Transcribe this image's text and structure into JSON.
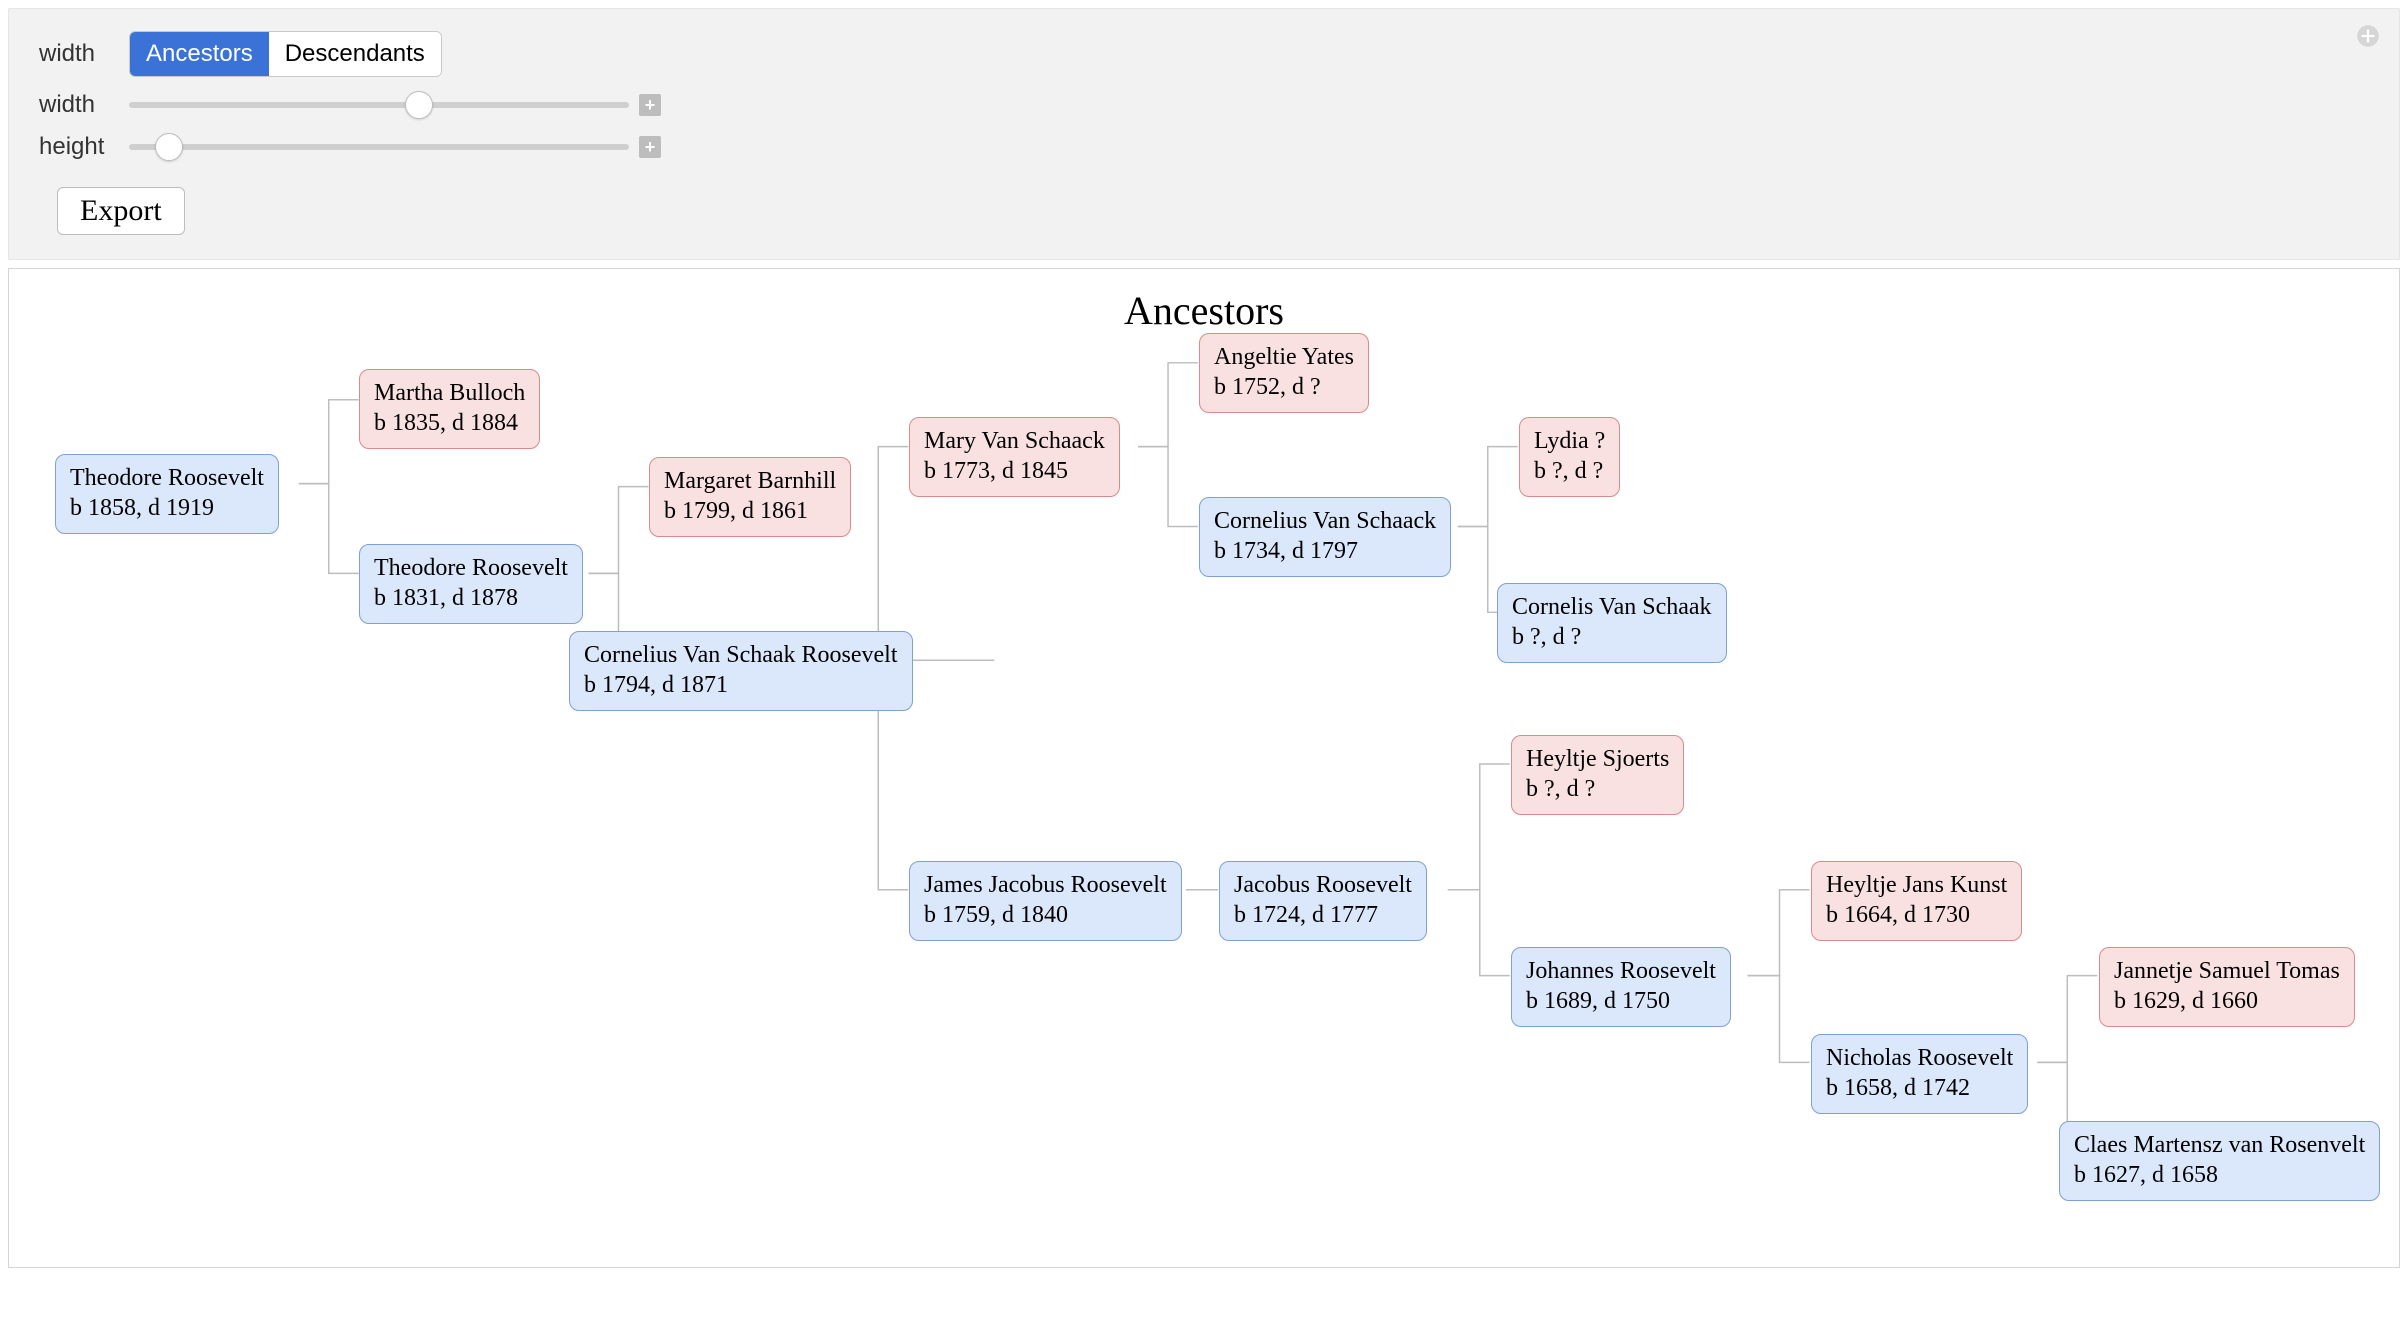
{
  "controls": {
    "mode_label": "width",
    "width_label": "width",
    "height_label": "height",
    "tab_ancestors": "Ancestors",
    "tab_descendants": "Descendants",
    "export_label": "Export",
    "width_slider_pct": 58,
    "height_slider_pct": 8
  },
  "diagram": {
    "title": "Ancestors"
  },
  "nodes": {
    "theodore_1858": {
      "name": "Theodore Roosevelt",
      "dates": "b 1858, d 1919",
      "gender": "male"
    },
    "martha_bulloch": {
      "name": "Martha Bulloch",
      "dates": "b 1835, d 1884",
      "gender": "female"
    },
    "theodore_1831": {
      "name": "Theodore Roosevelt",
      "dates": "b 1831, d 1878",
      "gender": "male"
    },
    "margaret_barnhill": {
      "name": "Margaret Barnhill",
      "dates": "b 1799, d 1861",
      "gender": "female"
    },
    "cornelius_vs_roosevelt": {
      "name": "Cornelius Van Schaak Roosevelt",
      "dates": "b 1794, d 1871",
      "gender": "male"
    },
    "mary_van_schaack": {
      "name": "Mary Van Schaack",
      "dates": "b 1773, d 1845",
      "gender": "female"
    },
    "james_jacobus": {
      "name": "James Jacobus Roosevelt",
      "dates": "b 1759, d 1840",
      "gender": "male"
    },
    "angeltie_yates": {
      "name": "Angeltie Yates",
      "dates": "b 1752, d ?",
      "gender": "female"
    },
    "cornelius_van_schaack": {
      "name": "Cornelius Van Schaack",
      "dates": "b 1734, d 1797",
      "gender": "male"
    },
    "lydia": {
      "name": "Lydia ?",
      "dates": "b ?, d ?",
      "gender": "female"
    },
    "cornelis_van_schaak": {
      "name": "Cornelis Van Schaak",
      "dates": "b ?, d ?",
      "gender": "male"
    },
    "jacobus_roosevelt": {
      "name": "Jacobus Roosevelt",
      "dates": "b 1724, d 1777",
      "gender": "male"
    },
    "heyltje_sjoerts": {
      "name": "Heyltje Sjoerts",
      "dates": "b ?, d ?",
      "gender": "female"
    },
    "johannes_roosevelt": {
      "name": "Johannes Roosevelt",
      "dates": "b 1689, d 1750",
      "gender": "male"
    },
    "heyltje_jans_kunst": {
      "name": "Heyltje Jans Kunst",
      "dates": "b 1664, d 1730",
      "gender": "female"
    },
    "nicholas_roosevelt": {
      "name": "Nicholas Roosevelt",
      "dates": "b 1658, d 1742",
      "gender": "male"
    },
    "jannetje_tomas": {
      "name": "Jannetje Samuel Tomas",
      "dates": "b 1629, d 1660",
      "gender": "female"
    },
    "claes_martensz": {
      "name": "Claes Martensz van Rosenvelt",
      "dates": "b 1627, d 1658",
      "gender": "male"
    }
  }
}
